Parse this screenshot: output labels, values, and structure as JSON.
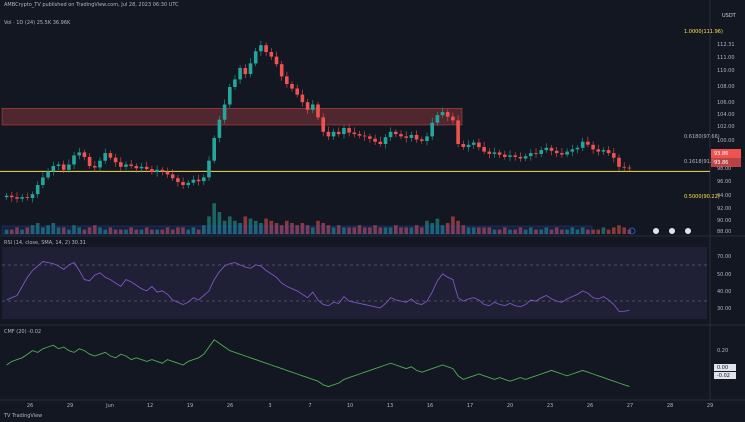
{
  "header": {
    "title_line": "AMBCrypto_TV published on TradingView.com, Jul 28, 2023 06:30 UTC",
    "indicator1_line": "Vol · 1D (24)  25.5K  36.96K"
  },
  "price_scale": {
    "currency": "USDT",
    "ticks": [
      "112.31",
      "111.00",
      "110.00",
      "108.00",
      "106.00",
      "104.00",
      "102.00",
      "100.00",
      "98.00",
      "96.00",
      "94.00",
      "92.00",
      "90.00",
      "88.00"
    ],
    "current_price": "93.86",
    "current_price_sub": "93.86"
  },
  "fib_levels": [
    {
      "label": "1.0000(111.96)"
    },
    {
      "label": "0.6180(97.66)"
    },
    {
      "label": "0.1618(91.54)"
    },
    {
      "label": "0.5000(90.22)"
    }
  ],
  "rsi_panel": {
    "header": "RSI (14, close, SMA, 14, 2)  30.31",
    "ticks": [
      "70.00",
      "50.00",
      "40.00",
      "30.00"
    ]
  },
  "cmf_panel": {
    "header": "CMF (20)  -0.02",
    "ticks": [
      "0.20",
      "0.00",
      "-0.02"
    ]
  },
  "x_axis": {
    "ticks": [
      "26",
      "29",
      "Jun",
      "12",
      "19",
      "26",
      "3",
      "7",
      "10",
      "13",
      "16",
      "17",
      "20",
      "23",
      "26",
      "27",
      "28",
      "29"
    ]
  },
  "footer": {
    "brand": "TV TradingView"
  },
  "colors": {
    "up": "#26a69a",
    "down": "#ef5350",
    "support_line": "#f5e14d",
    "resistance_zone": "#ef5350",
    "rsi_line": "#7e57c2",
    "cmf_line": "#4caf50"
  },
  "chart_data": {
    "type": "candlestick",
    "price_range": [
      88.0,
      113.0
    ],
    "resistance_zone": [
      100.5,
      102.7
    ],
    "support_level": 94.4,
    "closes": [
      91.2,
      91.0,
      90.8,
      91.0,
      90.9,
      91.4,
      92.6,
      93.6,
      94.4,
      95.1,
      95.3,
      94.6,
      95.3,
      96.5,
      96.9,
      96.3,
      95.1,
      94.9,
      95.8,
      96.8,
      96.2,
      95.6,
      95.0,
      95.3,
      95.1,
      94.8,
      95.0,
      94.7,
      94.3,
      94.6,
      94.4,
      94.0,
      93.5,
      93.0,
      92.6,
      92.9,
      93.3,
      93.1,
      93.6,
      95.8,
      98.8,
      101.2,
      103.2,
      105.5,
      106.5,
      108.0,
      107.2,
      108.6,
      110.2,
      111.0,
      110.1,
      109.5,
      108.5,
      106.9,
      105.9,
      105.3,
      104.5,
      103.5,
      102.5,
      103.2,
      101.5,
      99.6,
      99.0,
      99.6,
      99.3,
      100.1,
      99.5,
      99.3,
      99.1,
      99.0,
      98.7,
      98.3,
      98.0,
      98.9,
      99.6,
      99.3,
      99.0,
      98.8,
      99.2,
      98.6,
      98.4,
      99.0,
      100.8,
      101.8,
      102.2,
      101.6,
      101.1,
      98.0,
      97.6,
      97.9,
      98.2,
      97.6,
      97.0,
      96.7,
      96.9,
      96.6,
      96.3,
      96.5,
      96.3,
      96.1,
      96.4,
      96.8,
      96.7,
      97.2,
      97.5,
      97.1,
      96.8,
      96.6,
      97.0,
      97.3,
      97.5,
      98.3,
      97.9,
      97.3,
      97.0,
      97.2,
      96.8,
      96.2,
      95.0,
      94.9,
      94.8
    ],
    "volume": [
      2,
      2,
      3,
      2,
      3,
      4,
      5,
      3,
      4,
      5,
      3,
      3,
      2,
      4,
      3,
      2,
      3,
      4,
      3,
      2,
      3,
      2,
      2,
      2,
      3,
      2,
      2,
      3,
      2,
      2,
      2,
      3,
      2,
      3,
      3,
      2,
      3,
      2,
      4,
      8,
      14,
      10,
      6,
      8,
      6,
      5,
      8,
      7,
      6,
      5,
      7,
      6,
      5,
      4,
      6,
      5,
      4,
      5,
      4,
      3,
      6,
      5,
      4,
      3,
      4,
      3,
      3,
      3,
      4,
      3,
      3,
      4,
      3,
      3,
      3,
      4,
      3,
      3,
      3,
      4,
      3,
      6,
      5,
      7,
      4,
      5,
      8,
      6,
      4,
      3,
      3,
      3,
      3,
      3,
      2,
      2,
      3,
      2,
      2,
      3,
      2,
      3,
      2,
      2,
      3,
      2,
      3,
      2,
      2,
      3,
      2,
      3,
      2,
      2,
      2,
      3,
      2,
      3,
      4,
      3,
      2
    ],
    "rsi": [
      40,
      42,
      44,
      52,
      60,
      66,
      70,
      74,
      73,
      72,
      70,
      67,
      71,
      73,
      66,
      58,
      57,
      62,
      64,
      60,
      58,
      55,
      52,
      58,
      56,
      53,
      50,
      48,
      52,
      47,
      48,
      45,
      40,
      38,
      36,
      38,
      42,
      40,
      44,
      48,
      58,
      65,
      70,
      72,
      73,
      71,
      69,
      68,
      71,
      70,
      66,
      63,
      60,
      55,
      52,
      50,
      48,
      45,
      42,
      47,
      40,
      36,
      35,
      38,
      37,
      43,
      39,
      38,
      37,
      36,
      35,
      34,
      33,
      37,
      42,
      40,
      39,
      38,
      41,
      37,
      36,
      39,
      47,
      57,
      63,
      60,
      58,
      42,
      39,
      41,
      42,
      40,
      36,
      35,
      38,
      36,
      35,
      37,
      35,
      34,
      36,
      40,
      39,
      42,
      44,
      41,
      39,
      38,
      41,
      43,
      45,
      48,
      46,
      42,
      41,
      43,
      40,
      36,
      30,
      30,
      31
    ],
    "cmf": [
      0.1,
      0.12,
      0.13,
      0.14,
      0.16,
      0.18,
      0.17,
      0.19,
      0.2,
      0.21,
      0.19,
      0.2,
      0.18,
      0.17,
      0.19,
      0.18,
      0.16,
      0.15,
      0.16,
      0.17,
      0.15,
      0.14,
      0.16,
      0.15,
      0.13,
      0.14,
      0.13,
      0.12,
      0.13,
      0.12,
      0.11,
      0.13,
      0.12,
      0.11,
      0.1,
      0.12,
      0.13,
      0.14,
      0.16,
      0.2,
      0.24,
      0.22,
      0.2,
      0.18,
      0.17,
      0.16,
      0.15,
      0.14,
      0.13,
      0.12,
      0.11,
      0.1,
      0.09,
      0.08,
      0.07,
      0.06,
      0.05,
      0.04,
      0.03,
      0.02,
      0.01,
      -0.01,
      -0.02,
      -0.01,
      0.0,
      0.02,
      0.03,
      0.04,
      0.05,
      0.06,
      0.07,
      0.08,
      0.09,
      0.1,
      0.11,
      0.1,
      0.09,
      0.08,
      0.09,
      0.07,
      0.06,
      0.07,
      0.08,
      0.09,
      0.1,
      0.09,
      0.08,
      0.04,
      0.02,
      0.03,
      0.04,
      0.05,
      0.04,
      0.03,
      0.02,
      0.03,
      0.02,
      0.01,
      0.02,
      0.03,
      0.02,
      0.03,
      0.04,
      0.05,
      0.06,
      0.07,
      0.06,
      0.05,
      0.04,
      0.05,
      0.06,
      0.07,
      0.06,
      0.05,
      0.04,
      0.03,
      0.02,
      0.01,
      0.0,
      -0.01,
      -0.02
    ]
  }
}
